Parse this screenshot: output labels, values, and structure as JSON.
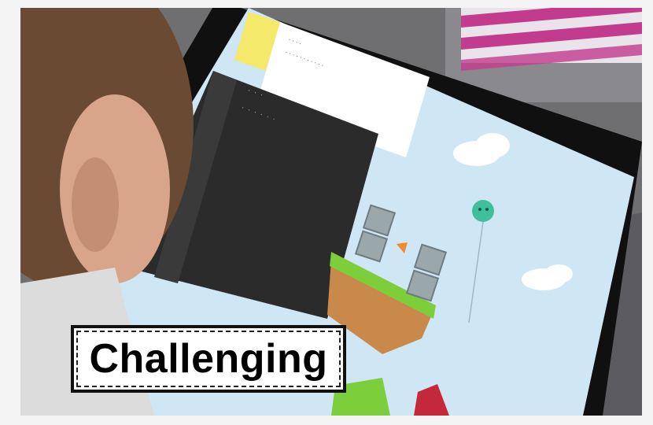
{
  "label": {
    "text": "Challenging"
  },
  "scene": {
    "description_icons": [
      "tablet",
      "child",
      "code-editor",
      "game-level",
      "balloon",
      "cloud"
    ],
    "colors": {
      "sky": "#cfe6f5",
      "grass": "#7ccf3a",
      "dirt": "#c9894a",
      "editor": "#2b2b2b",
      "dialog_tab": "#f4e96a",
      "balloon": "#3fbf9a"
    }
  }
}
